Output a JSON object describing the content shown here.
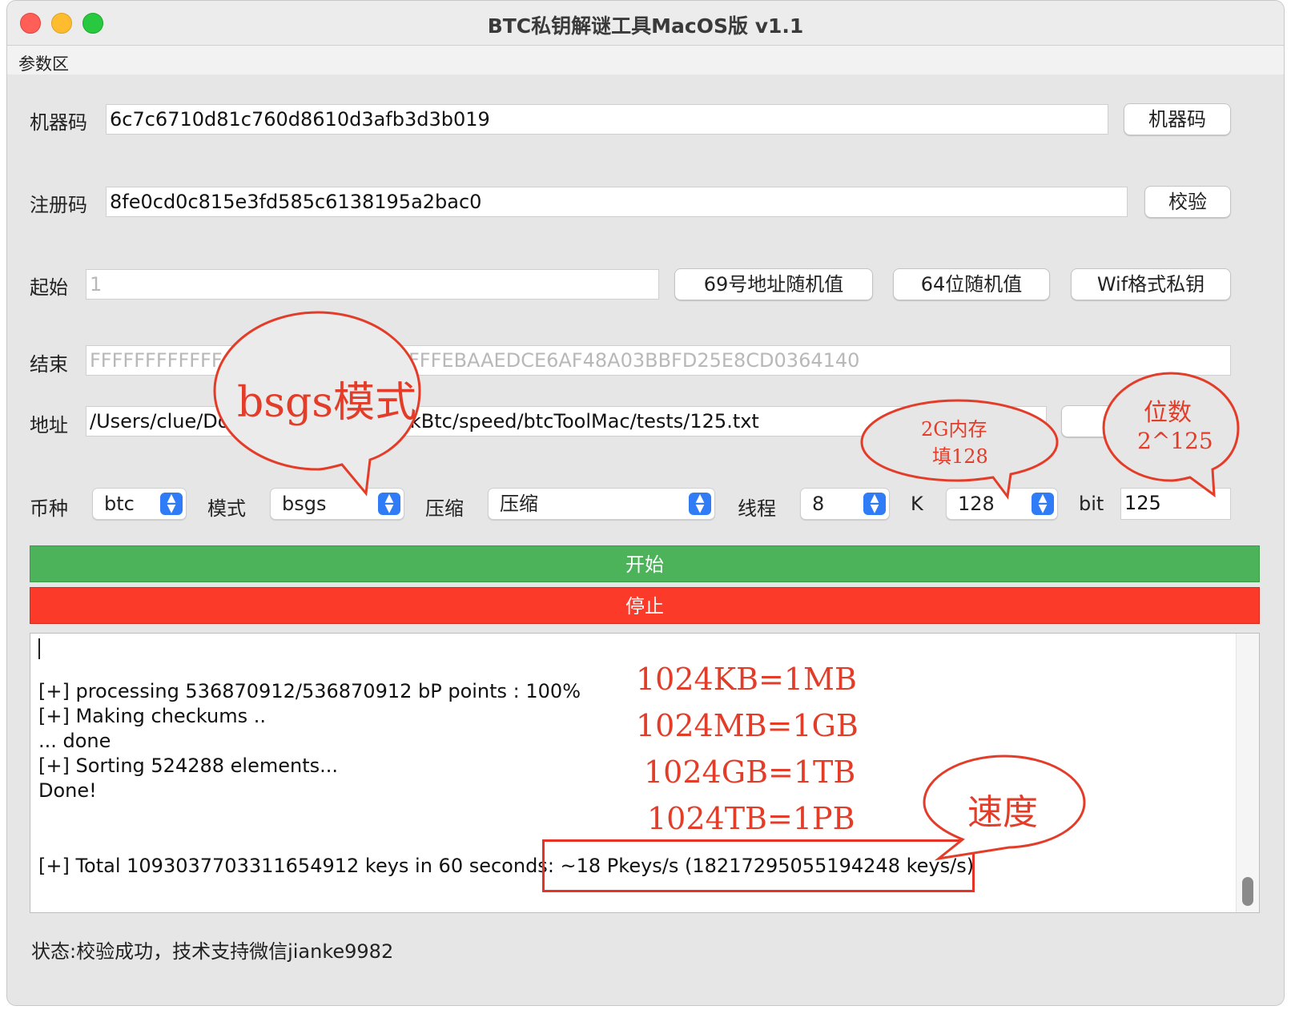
{
  "window": {
    "title": "BTC私钥解谜工具MacOS版 v1.1",
    "menu": "参数区"
  },
  "fields": {
    "machine_label": "机器码",
    "machine_value": "6c7c6710d81c760d8610d3afb3d3b019",
    "machine_button": "机器码",
    "reg_label": "注册码",
    "reg_value": "8fe0cd0c815e3fd585c6138195a2bac0",
    "reg_button": "校验",
    "start_label": "起始",
    "start_value": "1",
    "btn_69": "69号地址随机值",
    "btn_64": "64位随机值",
    "btn_wif": "Wif格式私钥",
    "end_label": "结束",
    "end_value_left": "FFFFFFFFFFFF",
    "end_value_right": "FFFEBAAEDCE6AF48A03BBFD25E8CD0364140",
    "addr_label": "地址",
    "addr_value_left": "/Users/clue/Doc",
    "addr_value_right": "ackBtc/speed/btcToolMac/tests/125.txt"
  },
  "options": {
    "coin_label": "币种",
    "coin_value": "btc",
    "mode_label": "模式",
    "mode_value": "bsgs",
    "compress_label": "压缩",
    "compress_value": "压缩",
    "thread_label": "线程",
    "thread_value": "8",
    "k_label": "K",
    "k_value": "128",
    "bit_label": "bit",
    "bit_value": "125"
  },
  "actions": {
    "start": "开始",
    "stop": "停止"
  },
  "log": [
    "[+] processing 536870912/536870912 bP points : 100%",
    "[+] Making checkums ..",
    "... done",
    "[+] Sorting 524288 elements...",
    "Done!",
    "[+] Total 1093037703311654912 keys in 60 seconds: ",
    "~18 Pkeys/s (18217295055194248 keys/s)"
  ],
  "status": "状态:校验成功，技术支持微信jianke9982",
  "annotations": {
    "bsgs": "bsgs模式",
    "mem_line1": "2G内存",
    "mem_line2": "填128",
    "bits_line1": "位数",
    "bits_line2": "2^125",
    "units": [
      "1024KB=1MB",
      "1024MB=1GB",
      "1024GB=1TB",
      "1024TB=1PB"
    ],
    "speed": "速度"
  },
  "colors": {
    "start_bar": "#4cb35a",
    "stop_bar": "#fb3a2a",
    "annotation": "#e33d2a",
    "select_arrow": "#2f7cf6"
  }
}
